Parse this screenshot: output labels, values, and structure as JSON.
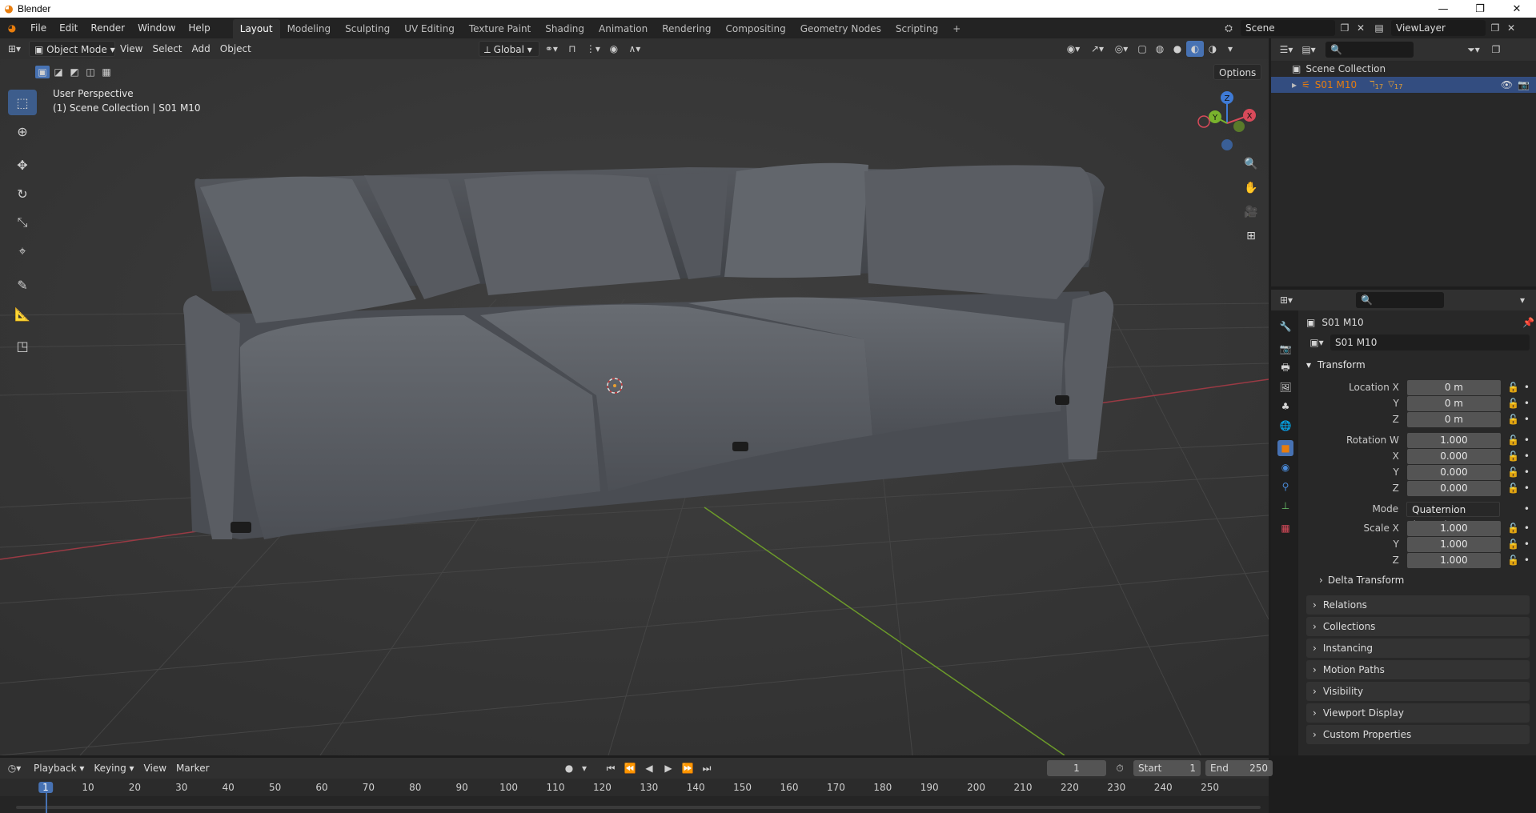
{
  "window": {
    "title": "Blender",
    "minimize": "—",
    "restore": "❐",
    "close": "✕"
  },
  "menu": [
    "File",
    "Edit",
    "Render",
    "Window",
    "Help"
  ],
  "workspaces": [
    "Layout",
    "Modeling",
    "Sculpting",
    "UV Editing",
    "Texture Paint",
    "Shading",
    "Animation",
    "Rendering",
    "Compositing",
    "Geometry Nodes",
    "Scripting",
    "+"
  ],
  "active_workspace": "Layout",
  "scene": {
    "label": "Scene",
    "viewlayer": "ViewLayer"
  },
  "viewport_header": {
    "mode": "Object Mode",
    "menus": [
      "View",
      "Select",
      "Add",
      "Object"
    ],
    "transform_orientation": "Global",
    "options": "Options"
  },
  "viewport": {
    "perspective": "User Perspective",
    "collection_info": "(1) Scene Collection | S01 M10",
    "gizmo_axes": {
      "x": "X",
      "y": "Y",
      "z": "Z"
    }
  },
  "outliner": {
    "root": "Scene Collection",
    "items": [
      {
        "name": "S01 M10",
        "modifiers": "17",
        "vertex_groups": "17"
      }
    ]
  },
  "properties": {
    "object_name": "S01 M10",
    "data_name": "S01 M10",
    "transform_title": "Transform",
    "location": {
      "label": "Location X",
      "x": "0 m",
      "y": "0 m",
      "z": "0 m"
    },
    "rotation": {
      "label": "Rotation W",
      "w": "1.000",
      "x": "0.000",
      "y": "0.000",
      "z": "0.000"
    },
    "mode": {
      "label": "Mode",
      "value": "Quaternion (WXYZ)"
    },
    "scale": {
      "label": "Scale X",
      "x": "1.000",
      "y": "1.000",
      "z": "1.000"
    },
    "axis_labels": {
      "y": "Y",
      "z": "Z",
      "x": "X"
    },
    "delta_transform": "Delta Transform",
    "panels": [
      "Relations",
      "Collections",
      "Instancing",
      "Motion Paths",
      "Visibility",
      "Viewport Display",
      "Custom Properties"
    ]
  },
  "timeline": {
    "menus": [
      "Playback",
      "Keying",
      "View",
      "Marker"
    ],
    "current_frame": "1",
    "start_label": "Start",
    "start": "1",
    "end_label": "End",
    "end": "250",
    "ruler": [
      "1",
      "10",
      "20",
      "30",
      "40",
      "50",
      "60",
      "70",
      "80",
      "90",
      "100",
      "110",
      "120",
      "130",
      "140",
      "150",
      "160",
      "170",
      "180",
      "190",
      "200",
      "210",
      "220",
      "230",
      "240",
      "250"
    ]
  },
  "colors": {
    "accent": "#4772b3",
    "active_tool": "#3d5d8c",
    "selected_row": "#334d80",
    "object_orange": "#e87d0d",
    "x_axis": "#d84a5a",
    "y_axis": "#79b32d",
    "z_axis": "#3f7bd6"
  }
}
